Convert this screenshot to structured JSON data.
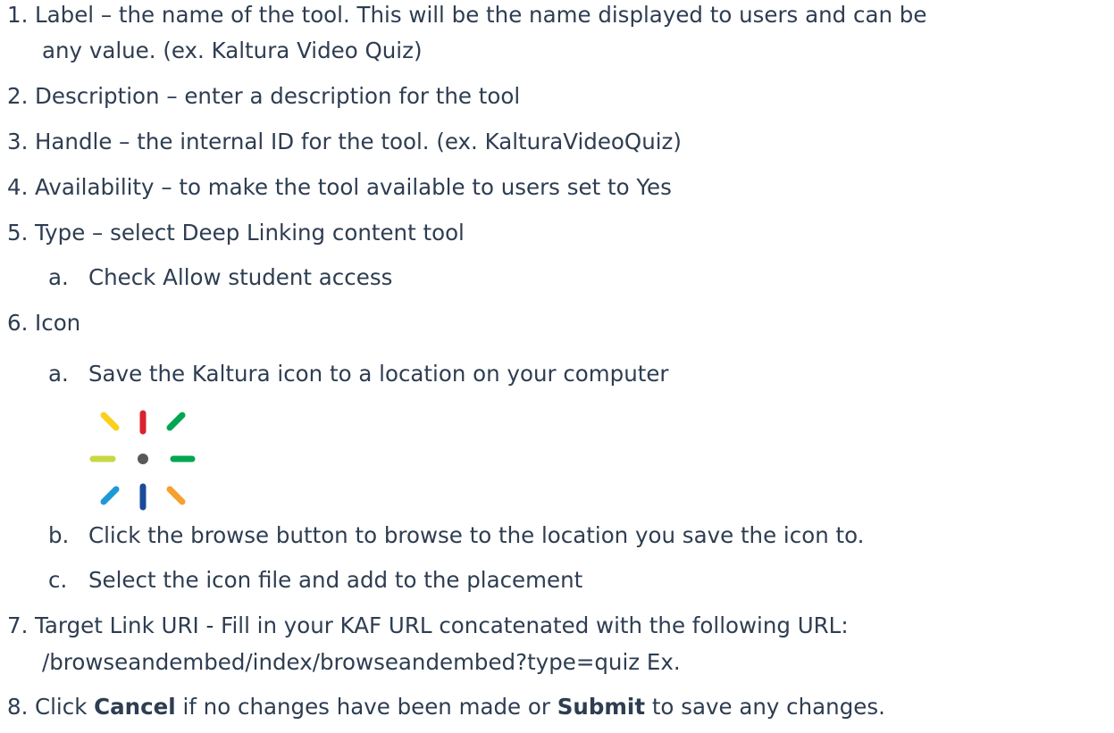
{
  "steps": [
    {
      "num": "1.",
      "text": "Label – the name of the tool.  This will be the name displayed to users  and can be",
      "cont": "any value.  (ex. Kaltura Video Quiz)"
    },
    {
      "num": "2.",
      "text": "Description – enter a description for the tool"
    },
    {
      "num": "3.",
      "text": "Handle – the internal ID for the tool. (ex. KalturaVideoQuiz)"
    },
    {
      "num": "4.",
      "text": "Availability – to make the tool available to users set to Yes"
    },
    {
      "num": "5.",
      "text": "Type – select Deep Linking content tool",
      "sub": [
        {
          "num": "a.",
          "text": "Check Allow student access"
        }
      ]
    },
    {
      "num": "6.",
      "text": "Icon",
      "sub": [
        {
          "num": "a.",
          "text": "Save the Kaltura icon to a location on your computer"
        },
        {
          "num": "b.",
          "text": "Click the browse button to browse to the location you save the icon to."
        },
        {
          "num": "c.",
          "text": "Select the icon file and add to the placement"
        }
      ]
    },
    {
      "num": "7.",
      "text": "Target Link URI - Fill in your KAF URL concatenated with the following URL:",
      "cont": "/browseandembed/index/browseandembed?type=quiz   Ex."
    },
    {
      "num": "8.",
      "text_a": "Click ",
      "bold_a": "Cancel",
      "text_b": " if no changes have been made or ",
      "bold_b": "Submit",
      "text_c": " to save any changes."
    }
  ],
  "icon": {
    "name": "kaltura-logo-icon",
    "colors": {
      "red": "#d9232e",
      "green_dark": "#00a651",
      "orange": "#f6a02d",
      "blue_dark": "#1a4b9b",
      "blue_light": "#1d9ad6",
      "lime": "#c8d746",
      "yellow": "#f9d11c",
      "center": "#58595b"
    }
  }
}
